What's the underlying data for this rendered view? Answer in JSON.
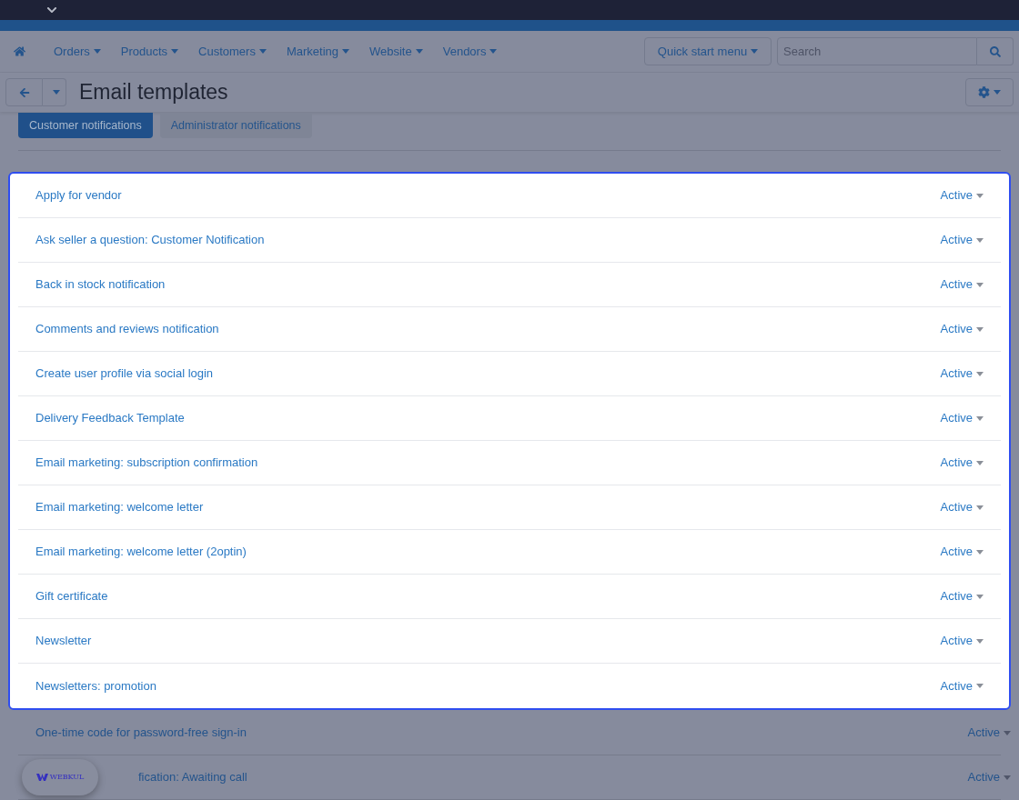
{
  "nav": {
    "items": [
      {
        "label": "Orders"
      },
      {
        "label": "Products"
      },
      {
        "label": "Customers"
      },
      {
        "label": "Marketing"
      },
      {
        "label": "Website"
      },
      {
        "label": "Vendors"
      }
    ],
    "quick_start": "Quick start menu",
    "search": {
      "placeholder": "Search"
    }
  },
  "page": {
    "title": "Email templates"
  },
  "tabs": [
    {
      "label": "Customer notifications",
      "selected": true
    },
    {
      "label": "Administrator notifications",
      "selected": false
    }
  ],
  "templates": [
    {
      "name": "Apply for vendor",
      "status": "Active",
      "highlighted": true
    },
    {
      "name": "Ask seller a question: Customer Notification",
      "status": "Active",
      "highlighted": true
    },
    {
      "name": "Back in stock notification",
      "status": "Active",
      "highlighted": true
    },
    {
      "name": "Comments and reviews notification",
      "status": "Active",
      "highlighted": true
    },
    {
      "name": "Create user profile via social login",
      "status": "Active",
      "highlighted": true
    },
    {
      "name": "Delivery Feedback Template",
      "status": "Active",
      "highlighted": true
    },
    {
      "name": "Email marketing: subscription confirmation",
      "status": "Active",
      "highlighted": true
    },
    {
      "name": "Email marketing: welcome letter",
      "status": "Active",
      "highlighted": true
    },
    {
      "name": "Email marketing: welcome letter (2optin)",
      "status": "Active",
      "highlighted": true
    },
    {
      "name": "Gift certificate",
      "status": "Active",
      "highlighted": true
    },
    {
      "name": "Newsletter",
      "status": "Active",
      "highlighted": true
    },
    {
      "name": "Newsletters: promotion",
      "status": "Active",
      "highlighted": true
    },
    {
      "name": "One-time code for password-free sign-in",
      "status": "Active",
      "highlighted": false
    },
    {
      "name": "fication: Awaiting call",
      "status": "Active",
      "highlighted": false,
      "covered": true
    }
  ],
  "badge": {
    "label": "WEBKUL"
  }
}
